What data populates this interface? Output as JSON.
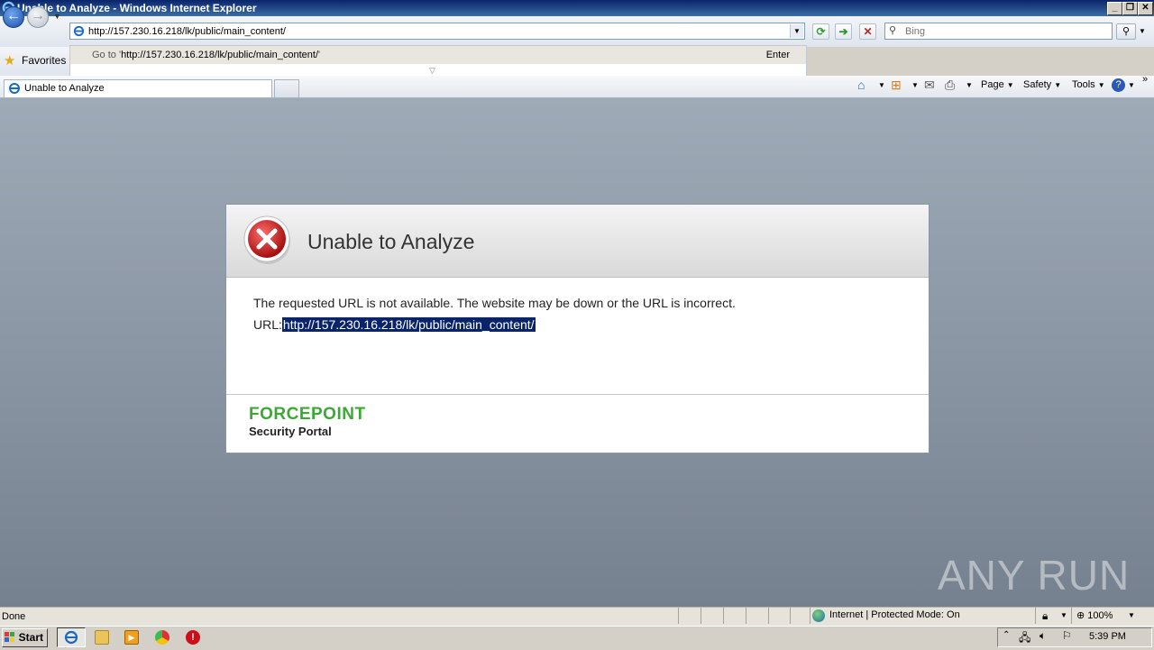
{
  "window": {
    "title": "Unable to Analyze - Windows Internet Explorer"
  },
  "nav": {
    "address": "http://157.230.16.218/lk/public/main_content/",
    "search_placeholder": "Bing"
  },
  "autocomplete": {
    "goto_prefix": "Go to '",
    "goto_url": "http://157.230.16.218/lk/public/main_content/",
    "goto_suffix": "'",
    "enter_label": "Enter"
  },
  "favorites": {
    "label": "Favorites"
  },
  "tabs": [
    {
      "label": "Unable to Analyze"
    }
  ],
  "commands": {
    "page": "Page",
    "safety": "Safety",
    "tools": "Tools"
  },
  "card": {
    "title": "Unable to Analyze",
    "message": "The requested URL is not available. The website may be down or the URL is incorrect.",
    "url_label": "URL:",
    "url_value": "http://157.230.16.218/lk/public/main_content/",
    "brand": "FORCEPOINT",
    "brand_sub": "Security Portal"
  },
  "watermark": "ANY RUN",
  "statusbar": {
    "text": "Done",
    "zone": "Internet | Protected Mode: On",
    "zoom": "100%"
  },
  "taskbar": {
    "start": "Start",
    "clock": "5:39 PM"
  },
  "colors": {
    "brand_green": "#3aaa35",
    "selection": "#0a246a",
    "title_bar": "#0a246a"
  }
}
